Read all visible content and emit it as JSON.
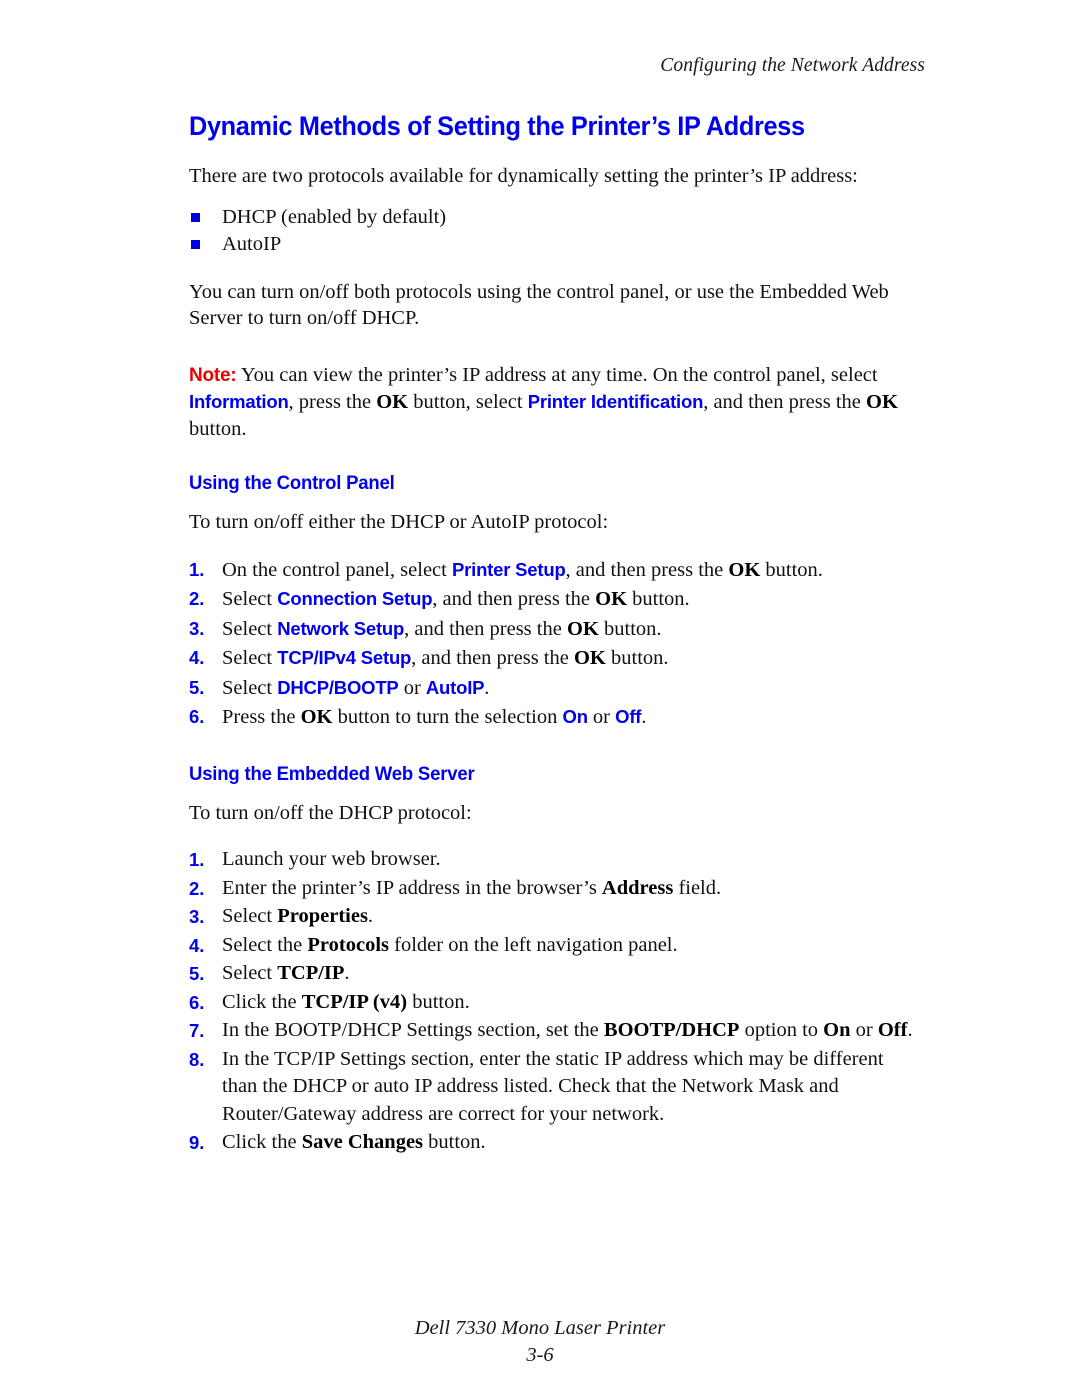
{
  "header": {
    "running_head": "Configuring the Network Address"
  },
  "title": "Dynamic Methods of Setting the Printer’s IP Address",
  "intro": {
    "paragraph": "There are two protocols available for dynamically setting the printer’s IP address:",
    "bullets": [
      "DHCP (enabled by default)",
      "AutoIP"
    ],
    "paragraph2": "You can turn on/off both protocols using the control panel, or use the Embedded Web Server to turn on/off DHCP."
  },
  "note": {
    "label": "Note:",
    "t1": " You can view the printer’s IP address at any time. On the control panel, select ",
    "ui1": "Information",
    "t2": ", press the ",
    "kb1": "OK",
    "t3": " button, select ",
    "ui2": "Printer Identification",
    "t4": ", and then press the ",
    "kb2": "OK",
    "t5": " button."
  },
  "control_panel": {
    "heading": "Using the Control Panel",
    "lead": "To turn on/off either the DHCP or AutoIP protocol:",
    "steps": [
      {
        "num": "1.",
        "t1": "On the control panel, select ",
        "ui1": "Printer Setup",
        "t2": ", and then press the ",
        "kb1": "OK",
        "t3": " button."
      },
      {
        "num": "2.",
        "t1": "Select ",
        "ui1": "Connection Setup",
        "t2": ", and then press the ",
        "kb1": "OK",
        "t3": " button."
      },
      {
        "num": "3.",
        "t1": "Select ",
        "ui1": "Network Setup",
        "t2": ", and then press the ",
        "kb1": "OK",
        "t3": " button."
      },
      {
        "num": "4.",
        "t1": "Select ",
        "ui1": "TCP/IPv4 Setup",
        "t2": ", and then press the ",
        "kb1": "OK",
        "t3": " button."
      },
      {
        "num": "5.",
        "t1": "Select ",
        "ui1": "DHCP/BOOTP",
        "t2": " or ",
        "ui2": "AutoIP",
        "t3": "."
      },
      {
        "num": "6.",
        "t1": "Press the ",
        "kb1": "OK",
        "t2": " button to turn the selection ",
        "ui1": "On",
        "t3": " or ",
        "ui2": "Off",
        "t4": "."
      }
    ]
  },
  "web_server": {
    "heading": "Using the Embedded Web Server",
    "lead": "To turn on/off the DHCP protocol:",
    "steps": [
      {
        "num": "1.",
        "t1": "Launch your web browser."
      },
      {
        "num": "2.",
        "t1": "Enter the printer’s IP address in the browser’s ",
        "kb1": "Address",
        "t2": " field."
      },
      {
        "num": "3.",
        "t1": "Select ",
        "kb1": "Properties",
        "t2": "."
      },
      {
        "num": "4.",
        "t1": "Select the ",
        "kb1": "Protocols",
        "t2": " folder on the left navigation panel."
      },
      {
        "num": "5.",
        "t1": "Select ",
        "kb1": "TCP/IP",
        "t2": "."
      },
      {
        "num": "6.",
        "t1": "Click the ",
        "kb1": "TCP/IP (v4)",
        "t2": " button."
      },
      {
        "num": "7.",
        "t1": "In the BOOTP/DHCP Settings section, set the ",
        "kb1": "BOOTP/DHCP",
        "t2": " option to ",
        "kb2": "On",
        "t3": " or ",
        "kb3": "Off",
        "t4": "."
      },
      {
        "num": "8.",
        "t1": "In the TCP/IP Settings section, enter the static IP address which may be different than the DHCP or auto IP address listed. Check that the Network Mask and Router/Gateway address are correct for your network."
      },
      {
        "num": "9.",
        "t1": "Click the ",
        "kb1": "Save Changes",
        "t2": " button."
      }
    ]
  },
  "footer": {
    "product": "Dell 7330 Mono Laser Printer",
    "page_number": "3-6"
  },
  "colors": {
    "accent_blue": "#0000ee",
    "note_red": "#ee0000",
    "text_black": "#111111"
  }
}
